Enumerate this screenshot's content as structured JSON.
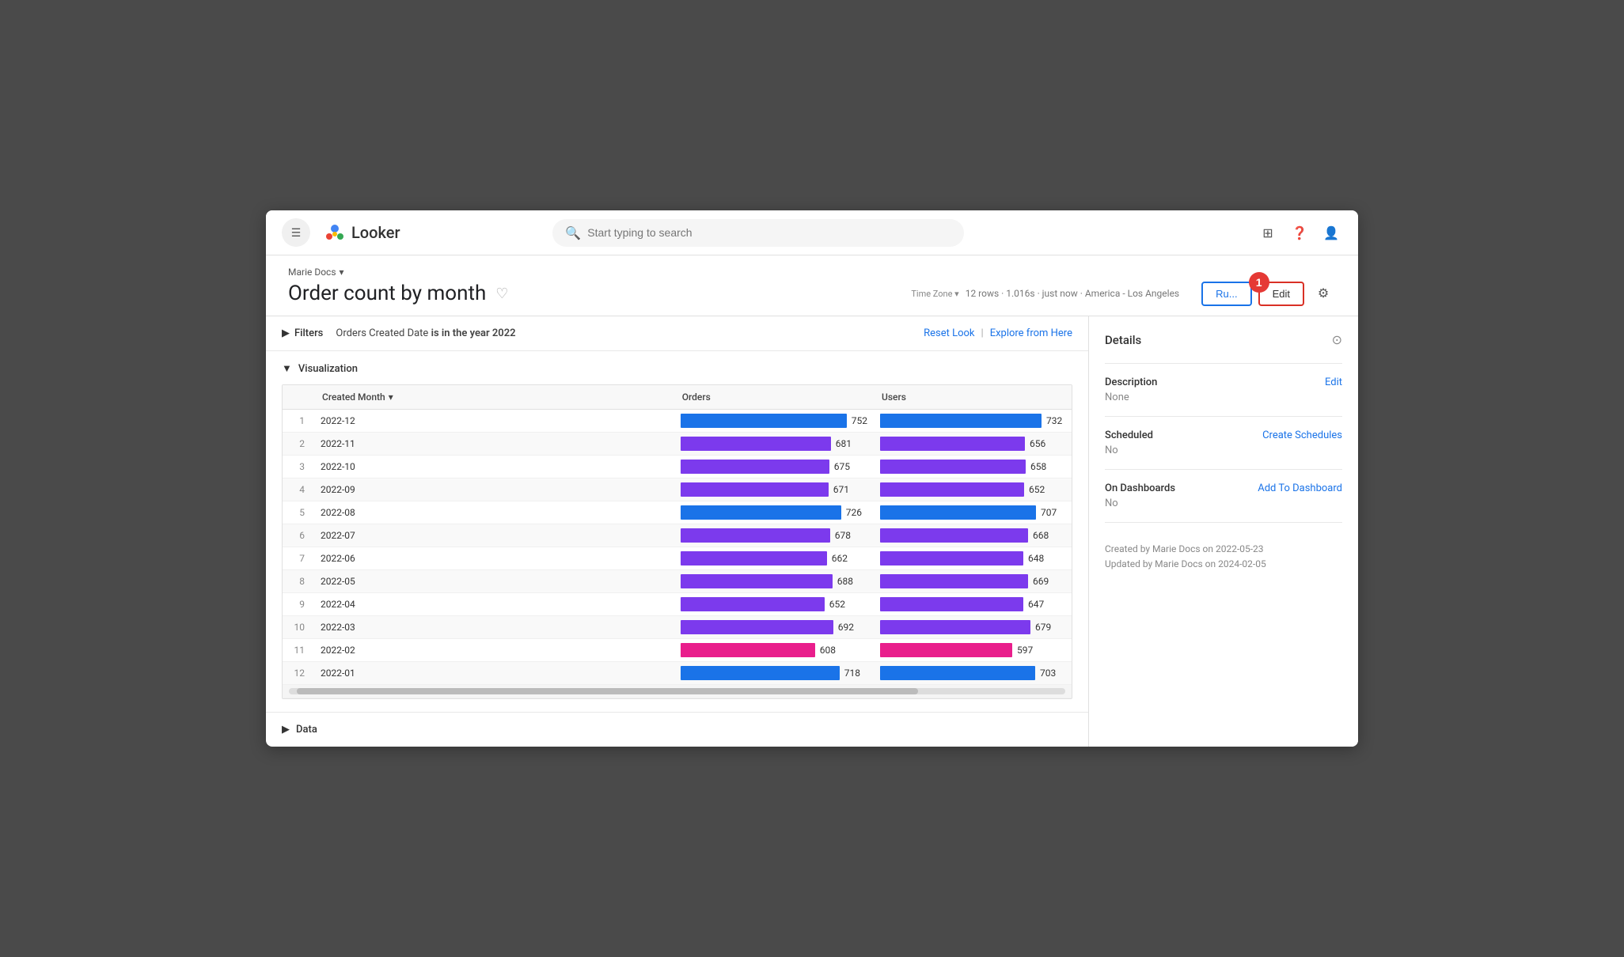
{
  "topbar": {
    "search_placeholder": "Start typing to search",
    "logo_text": "Looker"
  },
  "breadcrumb": {
    "label": "Marie Docs",
    "chevron": "▾"
  },
  "page": {
    "title": "Order count by month",
    "meta": "12 rows · 1.016s · just now · America - Los Angeles",
    "timezone_label": "Time Zone ▾",
    "run_label": "Ru...",
    "edit_label": "Edit",
    "badge": "1"
  },
  "filters": {
    "label": "Filters",
    "filter_text": "Orders Created Date",
    "filter_condition": "is in the year 2022",
    "reset_label": "Reset Look",
    "explore_label": "Explore from Here"
  },
  "visualization": {
    "label": "Visualization",
    "columns": {
      "row_num": "#",
      "created_month": "Created Month",
      "orders": "Orders",
      "users": "Users"
    },
    "rows": [
      {
        "num": 1,
        "month": "2022-12",
        "orders": 752,
        "orders_max": 752,
        "users": 732,
        "users_max": 752,
        "orders_color": "#1a73e8",
        "users_color": "#1a73e8"
      },
      {
        "num": 2,
        "month": "2022-11",
        "orders": 681,
        "orders_max": 752,
        "users": 656,
        "users_max": 752,
        "orders_color": "#7c3aed",
        "users_color": "#7c3aed"
      },
      {
        "num": 3,
        "month": "2022-10",
        "orders": 675,
        "orders_max": 752,
        "users": 658,
        "users_max": 752,
        "orders_color": "#7c3aed",
        "users_color": "#7c3aed"
      },
      {
        "num": 4,
        "month": "2022-09",
        "orders": 671,
        "orders_max": 752,
        "users": 652,
        "users_max": 752,
        "orders_color": "#7c3aed",
        "users_color": "#7c3aed"
      },
      {
        "num": 5,
        "month": "2022-08",
        "orders": 726,
        "orders_max": 752,
        "users": 707,
        "users_max": 752,
        "orders_color": "#1a73e8",
        "users_color": "#1a73e8"
      },
      {
        "num": 6,
        "month": "2022-07",
        "orders": 678,
        "orders_max": 752,
        "users": 668,
        "users_max": 752,
        "orders_color": "#7c3aed",
        "users_color": "#7c3aed"
      },
      {
        "num": 7,
        "month": "2022-06",
        "orders": 662,
        "orders_max": 752,
        "users": 648,
        "users_max": 752,
        "orders_color": "#7c3aed",
        "users_color": "#7c3aed"
      },
      {
        "num": 8,
        "month": "2022-05",
        "orders": 688,
        "orders_max": 752,
        "users": 669,
        "users_max": 752,
        "orders_color": "#7c3aed",
        "users_color": "#7c3aed"
      },
      {
        "num": 9,
        "month": "2022-04",
        "orders": 652,
        "orders_max": 752,
        "users": 647,
        "users_max": 752,
        "orders_color": "#7c3aed",
        "users_color": "#7c3aed"
      },
      {
        "num": 10,
        "month": "2022-03",
        "orders": 692,
        "orders_max": 752,
        "users": 679,
        "users_max": 752,
        "orders_color": "#7c3aed",
        "users_color": "#7c3aed"
      },
      {
        "num": 11,
        "month": "2022-02",
        "orders": 608,
        "orders_max": 752,
        "users": 597,
        "users_max": 752,
        "orders_color": "#e91e8c",
        "users_color": "#e91e8c"
      },
      {
        "num": 12,
        "month": "2022-01",
        "orders": 718,
        "orders_max": 752,
        "users": 703,
        "users_max": 752,
        "orders_color": "#1a73e8",
        "users_color": "#1a73e8"
      }
    ]
  },
  "data_section": {
    "label": "Data"
  },
  "details": {
    "title": "Details",
    "description_label": "Description",
    "description_value": "None",
    "description_edit": "Edit",
    "scheduled_label": "Scheduled",
    "scheduled_value": "No",
    "scheduled_action": "Create Schedules",
    "dashboards_label": "On Dashboards",
    "dashboards_value": "No",
    "dashboards_action": "Add To Dashboard",
    "created_meta": "Created by Marie Docs on 2022-05-23",
    "updated_meta": "Updated by Marie Docs on 2024-02-05"
  }
}
